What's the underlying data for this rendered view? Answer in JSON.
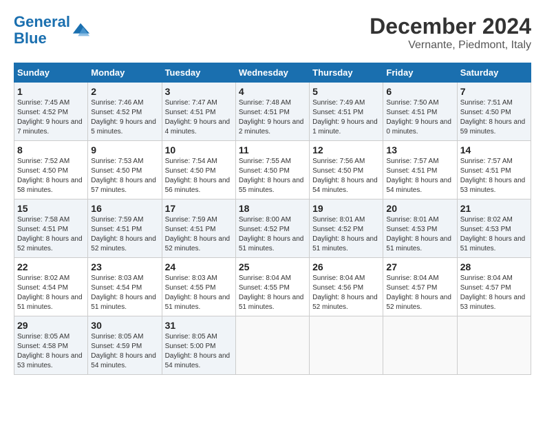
{
  "logo": {
    "line1": "General",
    "line2": "Blue"
  },
  "title": "December 2024",
  "subtitle": "Vernante, Piedmont, Italy",
  "days_header": [
    "Sunday",
    "Monday",
    "Tuesday",
    "Wednesday",
    "Thursday",
    "Friday",
    "Saturday"
  ],
  "weeks": [
    [
      {
        "day": "1",
        "sunrise": "7:45 AM",
        "sunset": "4:52 PM",
        "daylight": "9 hours and 7 minutes."
      },
      {
        "day": "2",
        "sunrise": "7:46 AM",
        "sunset": "4:52 PM",
        "daylight": "9 hours and 5 minutes."
      },
      {
        "day": "3",
        "sunrise": "7:47 AM",
        "sunset": "4:51 PM",
        "daylight": "9 hours and 4 minutes."
      },
      {
        "day": "4",
        "sunrise": "7:48 AM",
        "sunset": "4:51 PM",
        "daylight": "9 hours and 2 minutes."
      },
      {
        "day": "5",
        "sunrise": "7:49 AM",
        "sunset": "4:51 PM",
        "daylight": "9 hours and 1 minute."
      },
      {
        "day": "6",
        "sunrise": "7:50 AM",
        "sunset": "4:51 PM",
        "daylight": "9 hours and 0 minutes."
      },
      {
        "day": "7",
        "sunrise": "7:51 AM",
        "sunset": "4:50 PM",
        "daylight": "8 hours and 59 minutes."
      }
    ],
    [
      {
        "day": "8",
        "sunrise": "7:52 AM",
        "sunset": "4:50 PM",
        "daylight": "8 hours and 58 minutes."
      },
      {
        "day": "9",
        "sunrise": "7:53 AM",
        "sunset": "4:50 PM",
        "daylight": "8 hours and 57 minutes."
      },
      {
        "day": "10",
        "sunrise": "7:54 AM",
        "sunset": "4:50 PM",
        "daylight": "8 hours and 56 minutes."
      },
      {
        "day": "11",
        "sunrise": "7:55 AM",
        "sunset": "4:50 PM",
        "daylight": "8 hours and 55 minutes."
      },
      {
        "day": "12",
        "sunrise": "7:56 AM",
        "sunset": "4:50 PM",
        "daylight": "8 hours and 54 minutes."
      },
      {
        "day": "13",
        "sunrise": "7:57 AM",
        "sunset": "4:51 PM",
        "daylight": "8 hours and 54 minutes."
      },
      {
        "day": "14",
        "sunrise": "7:57 AM",
        "sunset": "4:51 PM",
        "daylight": "8 hours and 53 minutes."
      }
    ],
    [
      {
        "day": "15",
        "sunrise": "7:58 AM",
        "sunset": "4:51 PM",
        "daylight": "8 hours and 52 minutes."
      },
      {
        "day": "16",
        "sunrise": "7:59 AM",
        "sunset": "4:51 PM",
        "daylight": "8 hours and 52 minutes."
      },
      {
        "day": "17",
        "sunrise": "7:59 AM",
        "sunset": "4:51 PM",
        "daylight": "8 hours and 52 minutes."
      },
      {
        "day": "18",
        "sunrise": "8:00 AM",
        "sunset": "4:52 PM",
        "daylight": "8 hours and 51 minutes."
      },
      {
        "day": "19",
        "sunrise": "8:01 AM",
        "sunset": "4:52 PM",
        "daylight": "8 hours and 51 minutes."
      },
      {
        "day": "20",
        "sunrise": "8:01 AM",
        "sunset": "4:53 PM",
        "daylight": "8 hours and 51 minutes."
      },
      {
        "day": "21",
        "sunrise": "8:02 AM",
        "sunset": "4:53 PM",
        "daylight": "8 hours and 51 minutes."
      }
    ],
    [
      {
        "day": "22",
        "sunrise": "8:02 AM",
        "sunset": "4:54 PM",
        "daylight": "8 hours and 51 minutes."
      },
      {
        "day": "23",
        "sunrise": "8:03 AM",
        "sunset": "4:54 PM",
        "daylight": "8 hours and 51 minutes."
      },
      {
        "day": "24",
        "sunrise": "8:03 AM",
        "sunset": "4:55 PM",
        "daylight": "8 hours and 51 minutes."
      },
      {
        "day": "25",
        "sunrise": "8:04 AM",
        "sunset": "4:55 PM",
        "daylight": "8 hours and 51 minutes."
      },
      {
        "day": "26",
        "sunrise": "8:04 AM",
        "sunset": "4:56 PM",
        "daylight": "8 hours and 52 minutes."
      },
      {
        "day": "27",
        "sunrise": "8:04 AM",
        "sunset": "4:57 PM",
        "daylight": "8 hours and 52 minutes."
      },
      {
        "day": "28",
        "sunrise": "8:04 AM",
        "sunset": "4:57 PM",
        "daylight": "8 hours and 53 minutes."
      }
    ],
    [
      {
        "day": "29",
        "sunrise": "8:05 AM",
        "sunset": "4:58 PM",
        "daylight": "8 hours and 53 minutes."
      },
      {
        "day": "30",
        "sunrise": "8:05 AM",
        "sunset": "4:59 PM",
        "daylight": "8 hours and 54 minutes."
      },
      {
        "day": "31",
        "sunrise": "8:05 AM",
        "sunset": "5:00 PM",
        "daylight": "8 hours and 54 minutes."
      },
      null,
      null,
      null,
      null
    ]
  ]
}
